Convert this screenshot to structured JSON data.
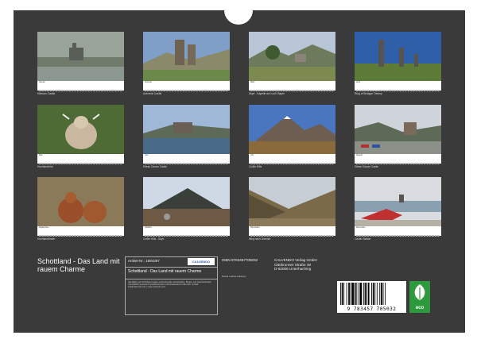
{
  "calendar": {
    "title": "Schottland - Das Land mit rauem Charme",
    "months": [
      {
        "month": "Januar",
        "caption": "Kilchurn Castle"
      },
      {
        "month": "Februar",
        "caption": "Ardvreck Castle"
      },
      {
        "month": "März",
        "caption": "Skye - Kapelle am Loch Slapin"
      },
      {
        "month": "April",
        "caption": "Ring of Brodgar Orkney"
      },
      {
        "month": "Mai",
        "caption": "Hochlandrind"
      },
      {
        "month": "Juni",
        "caption": "Eilean Donan Castle"
      },
      {
        "month": "Juli",
        "caption": "Cuillin Hills"
      },
      {
        "month": "August",
        "caption": "Eilean Donan Castle"
      },
      {
        "month": "September",
        "caption": "Hochlandrinder"
      },
      {
        "month": "Oktober",
        "caption": "Cuillin Hills - Skye"
      },
      {
        "month": "November",
        "caption": "Weg nach Garnish"
      },
      {
        "month": "Dezember",
        "caption": "Castle Stalker"
      }
    ]
  },
  "info": {
    "article": "Artikel-Nr.: 1984397",
    "brand": "CALVENDO",
    "subtitle": "Schottland - Das Land mit rauem Charme",
    "description": "Alle Bilder aus Schottland zeigen eindrucksvolle Landschaften, Burgen und Hochlandrinder. CALVENDO produziert bedarfsorientiert und klimaneutral in DE & EU. E-Mail: info@calvendo.com | www.calvendo.com",
    "isbn": "ISBN 9783457705032",
    "artist": "Nicole Lauher-Harksny",
    "publisher": [
      "CALVENDO Verlag GmbH",
      "Ottobrunner Straße 39",
      "D-82008 Unterhaching"
    ],
    "barcode": "9 783457 705032",
    "eco": "eco"
  },
  "colors": {
    "background": "#3a3a3a",
    "accent": "#2e9a3e"
  }
}
